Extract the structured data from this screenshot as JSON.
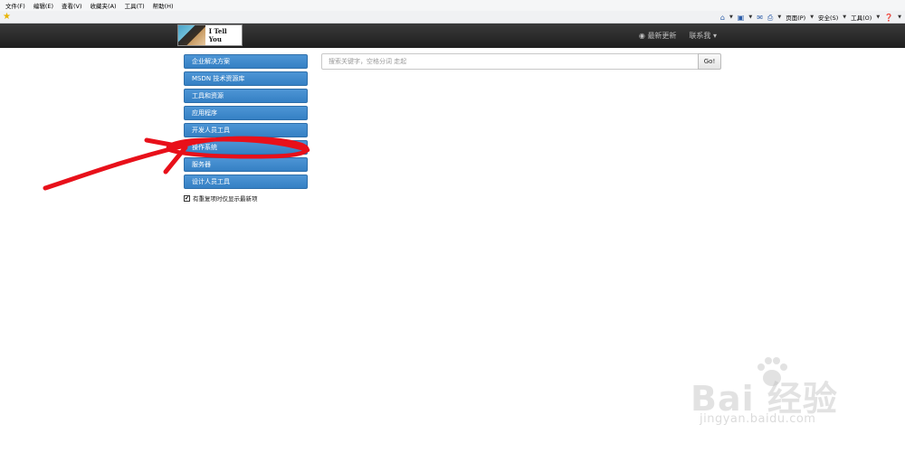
{
  "browser": {
    "menu": [
      "文件(F)",
      "编辑(E)",
      "查看(V)",
      "收藏夹(A)",
      "工具(T)",
      "帮助(H)"
    ],
    "toolbar": {
      "page_label": "页面(P)",
      "safety_label": "安全(S)",
      "tools_label": "工具(O)"
    }
  },
  "site": {
    "logo_text": "I Tell You",
    "nav": {
      "latest": "最新更新",
      "contact": "联系我 ▾"
    }
  },
  "sidebar": {
    "items": [
      {
        "label": "企业解决方案"
      },
      {
        "label": "MSDN 技术资源库"
      },
      {
        "label": "工具和资源"
      },
      {
        "label": "应用程序"
      },
      {
        "label": "开发人员工具"
      },
      {
        "label": "操作系统"
      },
      {
        "label": "服务器"
      },
      {
        "label": "设计人员工具"
      }
    ],
    "checkbox": {
      "checked": true,
      "label": "有重复项时仅显示最新项"
    }
  },
  "search": {
    "placeholder": "搜索关键字，空格分词 走起",
    "button_label": "Go!"
  },
  "watermark": {
    "main": "Bai 经验",
    "sub": "jingyan.baidu.com"
  },
  "colors": {
    "sidebar_button": "#3a86c8",
    "navbar": "#262626",
    "annotation": "#e8101a"
  }
}
